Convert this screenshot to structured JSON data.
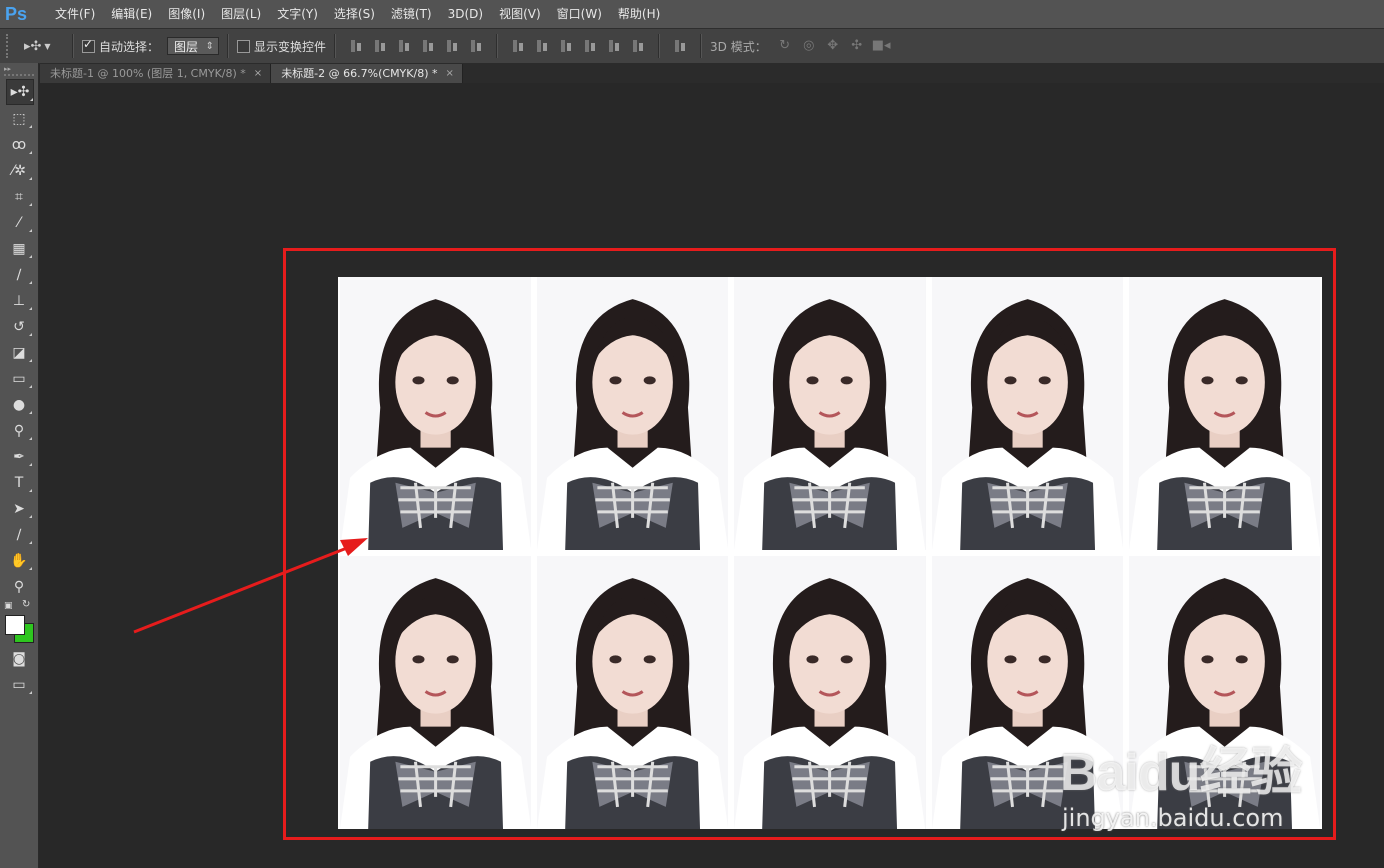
{
  "app": {
    "logo": "Ps"
  },
  "menu": [
    {
      "label": "文件(F)"
    },
    {
      "label": "编辑(E)"
    },
    {
      "label": "图像(I)"
    },
    {
      "label": "图层(L)"
    },
    {
      "label": "文字(Y)"
    },
    {
      "label": "选择(S)"
    },
    {
      "label": "滤镜(T)"
    },
    {
      "label": "3D(D)"
    },
    {
      "label": "视图(V)"
    },
    {
      "label": "窗口(W)"
    },
    {
      "label": "帮助(H)"
    }
  ],
  "options": {
    "tool_preset_icon": "move-tool-icon",
    "auto_select_label": "自动选择：",
    "auto_select_checked": true,
    "auto_select_value": "图层",
    "show_transform_label": "显示变换控件",
    "show_transform_checked": false,
    "mode3d_label": "3D 模式："
  },
  "tabs": [
    {
      "label": "未标题-1 @ 100% (图层 1, CMYK/8) *",
      "active": false
    },
    {
      "label": "未标题-2 @ 66.7%(CMYK/8) *",
      "active": true
    }
  ],
  "tools": [
    "move-tool-icon",
    "marquee-tool-icon",
    "lasso-tool-icon",
    "magic-wand-icon",
    "crop-tool-icon",
    "eyedropper-icon",
    "healing-brush-icon",
    "brush-tool-icon",
    "clone-stamp-icon",
    "history-brush-icon",
    "eraser-icon",
    "gradient-icon",
    "blur-tool-icon",
    "dodge-tool-icon",
    "pen-tool-icon",
    "type-tool-icon",
    "path-select-icon",
    "line-tool-icon",
    "hand-tool-icon",
    "zoom-tool-icon"
  ],
  "colors": {
    "foreground": "#ffffff",
    "background": "#2ec61f",
    "highlight": "#e61c1c",
    "ps_blue": "#4aa3f0"
  },
  "document": {
    "rows": 2,
    "columns": 5
  },
  "watermark": {
    "brand": "Baidu经验",
    "url": "jingyan.baidu.com"
  }
}
